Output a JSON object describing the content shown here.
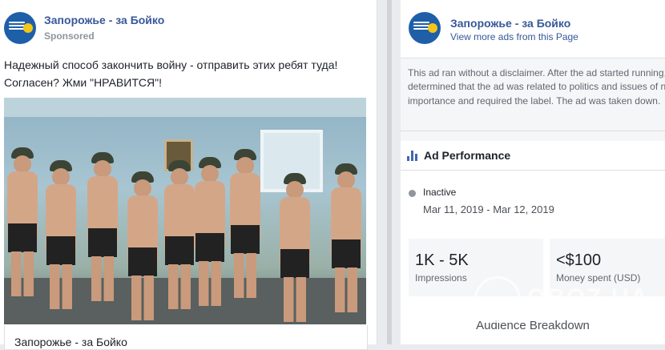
{
  "post": {
    "page_name": "Запорожье - за Бойко",
    "sponsored_label": "Sponsored",
    "text_line1": "Надежный способ закончить войну - отправить этих ребят туда!",
    "text_line2": "Согласен? Жми \"НРАВИТСЯ\"!",
    "footer_page_name": "Запорожье - за Бойко",
    "avatar_icon": "page-logo-icon"
  },
  "ad_panel": {
    "page_name": "Запорожье - за Бойко",
    "view_more_link": "View more ads from this Page",
    "disclaimer": "This ad ran without a disclaimer. After the ad started running, we determined that the ad was related to politics and issues of national importance and required the label. The ad was taken down.",
    "performance_title": "Ad Performance",
    "performance_icon": "bar-chart-icon",
    "status": "Inactive",
    "date_range": "Mar 11, 2019 - Mar 12, 2019",
    "impressions_value": "1K - 5K",
    "impressions_label": "Impressions",
    "spend_value": "<$100",
    "spend_label": "Money spent (USD)",
    "audience_heading": "Audience Breakdown"
  },
  "watermark": {
    "text": "OBOZ.UA"
  },
  "colors": {
    "link_blue": "#365899",
    "accent_blue": "#4267b2",
    "panel_bg": "#f5f6f7",
    "page_bg": "#e9ebee"
  }
}
